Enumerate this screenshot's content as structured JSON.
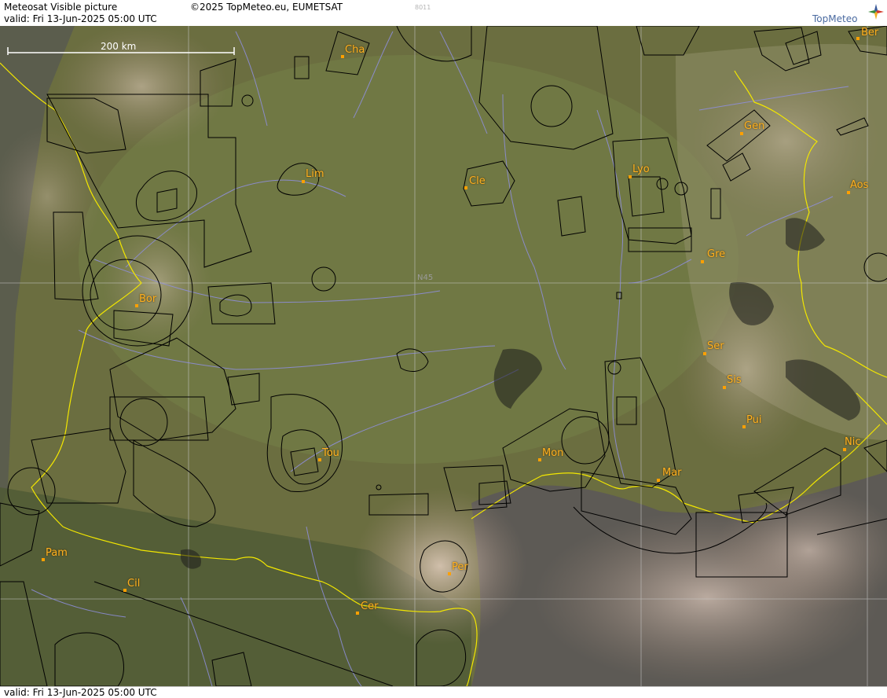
{
  "header": {
    "title": "Meteosat Visible picture",
    "copyright": "©2025 TopMeteo.eu, EUMETSAT",
    "valid": "valid:  Fri  13-Jun-2025  05:00 UTC",
    "image_id": "8011",
    "logo_text": "TopMeteo"
  },
  "footer": {
    "valid": "valid:  Fri  13-Jun-2025  05:00 UTC"
  },
  "map": {
    "scale_label": "200 km",
    "grid_label": "N45",
    "cities": [
      {
        "id": "cha",
        "label": "Cha"
      },
      {
        "id": "ber",
        "label": "Ber"
      },
      {
        "id": "gen",
        "label": "Gen"
      },
      {
        "id": "lim",
        "label": "Lim"
      },
      {
        "id": "cle",
        "label": "Cle"
      },
      {
        "id": "lyo",
        "label": "Lyo"
      },
      {
        "id": "aos",
        "label": "Aos"
      },
      {
        "id": "gre",
        "label": "Gre"
      },
      {
        "id": "bor",
        "label": "Bor"
      },
      {
        "id": "ser",
        "label": "Ser"
      },
      {
        "id": "sis",
        "label": "Sis"
      },
      {
        "id": "pui",
        "label": "Pui"
      },
      {
        "id": "tou",
        "label": "Tou"
      },
      {
        "id": "mon",
        "label": "Mon"
      },
      {
        "id": "mar",
        "label": "Mar"
      },
      {
        "id": "nic",
        "label": "Nic"
      },
      {
        "id": "pam",
        "label": "Pam"
      },
      {
        "id": "per",
        "label": "Per"
      },
      {
        "id": "cil",
        "label": "Cil"
      },
      {
        "id": "cer",
        "label": "Cer"
      }
    ]
  },
  "colors": {
    "border_line": "#f2e600",
    "river_line": "#8f8fe0",
    "airspace_line": "#000000",
    "city_label": "#ffb020",
    "grid_line": "#c8c8c8"
  }
}
